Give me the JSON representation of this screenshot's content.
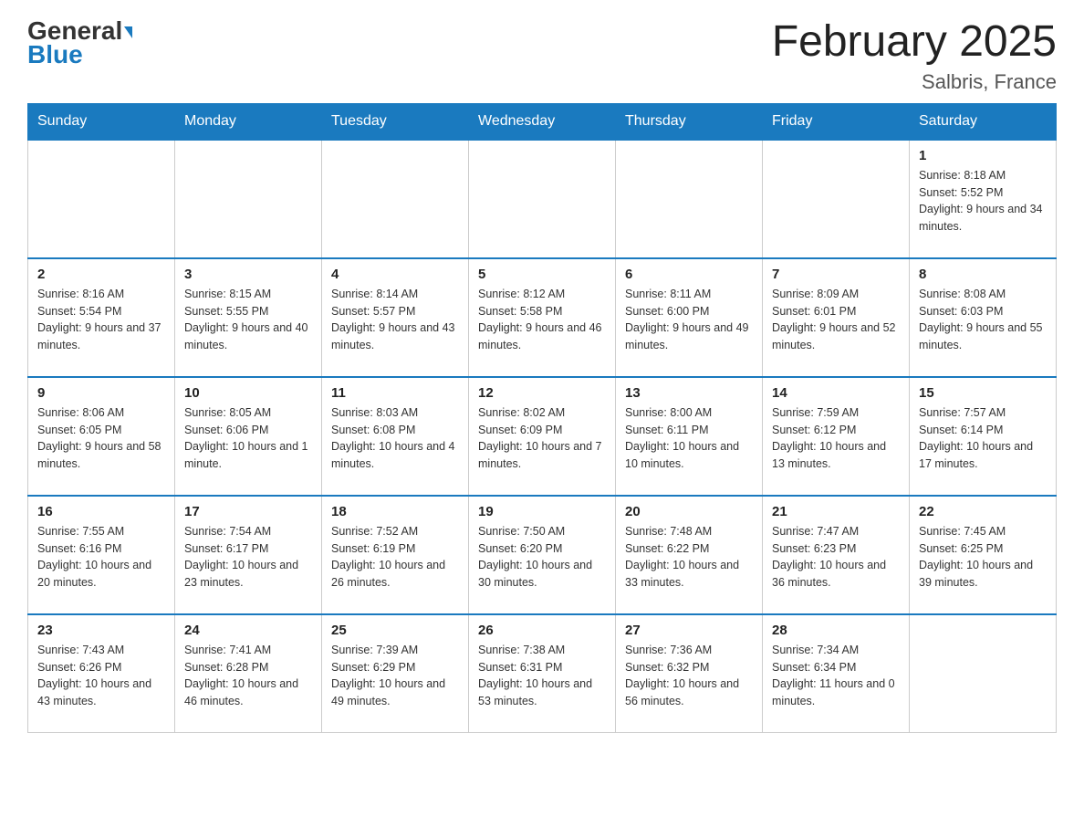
{
  "header": {
    "logo_general": "General",
    "logo_blue": "Blue",
    "month_title": "February 2025",
    "location": "Salbris, France"
  },
  "days_of_week": [
    "Sunday",
    "Monday",
    "Tuesday",
    "Wednesday",
    "Thursday",
    "Friday",
    "Saturday"
  ],
  "weeks": [
    [
      {
        "day": "",
        "info": ""
      },
      {
        "day": "",
        "info": ""
      },
      {
        "day": "",
        "info": ""
      },
      {
        "day": "",
        "info": ""
      },
      {
        "day": "",
        "info": ""
      },
      {
        "day": "",
        "info": ""
      },
      {
        "day": "1",
        "info": "Sunrise: 8:18 AM\nSunset: 5:52 PM\nDaylight: 9 hours and 34 minutes."
      }
    ],
    [
      {
        "day": "2",
        "info": "Sunrise: 8:16 AM\nSunset: 5:54 PM\nDaylight: 9 hours and 37 minutes."
      },
      {
        "day": "3",
        "info": "Sunrise: 8:15 AM\nSunset: 5:55 PM\nDaylight: 9 hours and 40 minutes."
      },
      {
        "day": "4",
        "info": "Sunrise: 8:14 AM\nSunset: 5:57 PM\nDaylight: 9 hours and 43 minutes."
      },
      {
        "day": "5",
        "info": "Sunrise: 8:12 AM\nSunset: 5:58 PM\nDaylight: 9 hours and 46 minutes."
      },
      {
        "day": "6",
        "info": "Sunrise: 8:11 AM\nSunset: 6:00 PM\nDaylight: 9 hours and 49 minutes."
      },
      {
        "day": "7",
        "info": "Sunrise: 8:09 AM\nSunset: 6:01 PM\nDaylight: 9 hours and 52 minutes."
      },
      {
        "day": "8",
        "info": "Sunrise: 8:08 AM\nSunset: 6:03 PM\nDaylight: 9 hours and 55 minutes."
      }
    ],
    [
      {
        "day": "9",
        "info": "Sunrise: 8:06 AM\nSunset: 6:05 PM\nDaylight: 9 hours and 58 minutes."
      },
      {
        "day": "10",
        "info": "Sunrise: 8:05 AM\nSunset: 6:06 PM\nDaylight: 10 hours and 1 minute."
      },
      {
        "day": "11",
        "info": "Sunrise: 8:03 AM\nSunset: 6:08 PM\nDaylight: 10 hours and 4 minutes."
      },
      {
        "day": "12",
        "info": "Sunrise: 8:02 AM\nSunset: 6:09 PM\nDaylight: 10 hours and 7 minutes."
      },
      {
        "day": "13",
        "info": "Sunrise: 8:00 AM\nSunset: 6:11 PM\nDaylight: 10 hours and 10 minutes."
      },
      {
        "day": "14",
        "info": "Sunrise: 7:59 AM\nSunset: 6:12 PM\nDaylight: 10 hours and 13 minutes."
      },
      {
        "day": "15",
        "info": "Sunrise: 7:57 AM\nSunset: 6:14 PM\nDaylight: 10 hours and 17 minutes."
      }
    ],
    [
      {
        "day": "16",
        "info": "Sunrise: 7:55 AM\nSunset: 6:16 PM\nDaylight: 10 hours and 20 minutes."
      },
      {
        "day": "17",
        "info": "Sunrise: 7:54 AM\nSunset: 6:17 PM\nDaylight: 10 hours and 23 minutes."
      },
      {
        "day": "18",
        "info": "Sunrise: 7:52 AM\nSunset: 6:19 PM\nDaylight: 10 hours and 26 minutes."
      },
      {
        "day": "19",
        "info": "Sunrise: 7:50 AM\nSunset: 6:20 PM\nDaylight: 10 hours and 30 minutes."
      },
      {
        "day": "20",
        "info": "Sunrise: 7:48 AM\nSunset: 6:22 PM\nDaylight: 10 hours and 33 minutes."
      },
      {
        "day": "21",
        "info": "Sunrise: 7:47 AM\nSunset: 6:23 PM\nDaylight: 10 hours and 36 minutes."
      },
      {
        "day": "22",
        "info": "Sunrise: 7:45 AM\nSunset: 6:25 PM\nDaylight: 10 hours and 39 minutes."
      }
    ],
    [
      {
        "day": "23",
        "info": "Sunrise: 7:43 AM\nSunset: 6:26 PM\nDaylight: 10 hours and 43 minutes."
      },
      {
        "day": "24",
        "info": "Sunrise: 7:41 AM\nSunset: 6:28 PM\nDaylight: 10 hours and 46 minutes."
      },
      {
        "day": "25",
        "info": "Sunrise: 7:39 AM\nSunset: 6:29 PM\nDaylight: 10 hours and 49 minutes."
      },
      {
        "day": "26",
        "info": "Sunrise: 7:38 AM\nSunset: 6:31 PM\nDaylight: 10 hours and 53 minutes."
      },
      {
        "day": "27",
        "info": "Sunrise: 7:36 AM\nSunset: 6:32 PM\nDaylight: 10 hours and 56 minutes."
      },
      {
        "day": "28",
        "info": "Sunrise: 7:34 AM\nSunset: 6:34 PM\nDaylight: 11 hours and 0 minutes."
      },
      {
        "day": "",
        "info": ""
      }
    ]
  ]
}
